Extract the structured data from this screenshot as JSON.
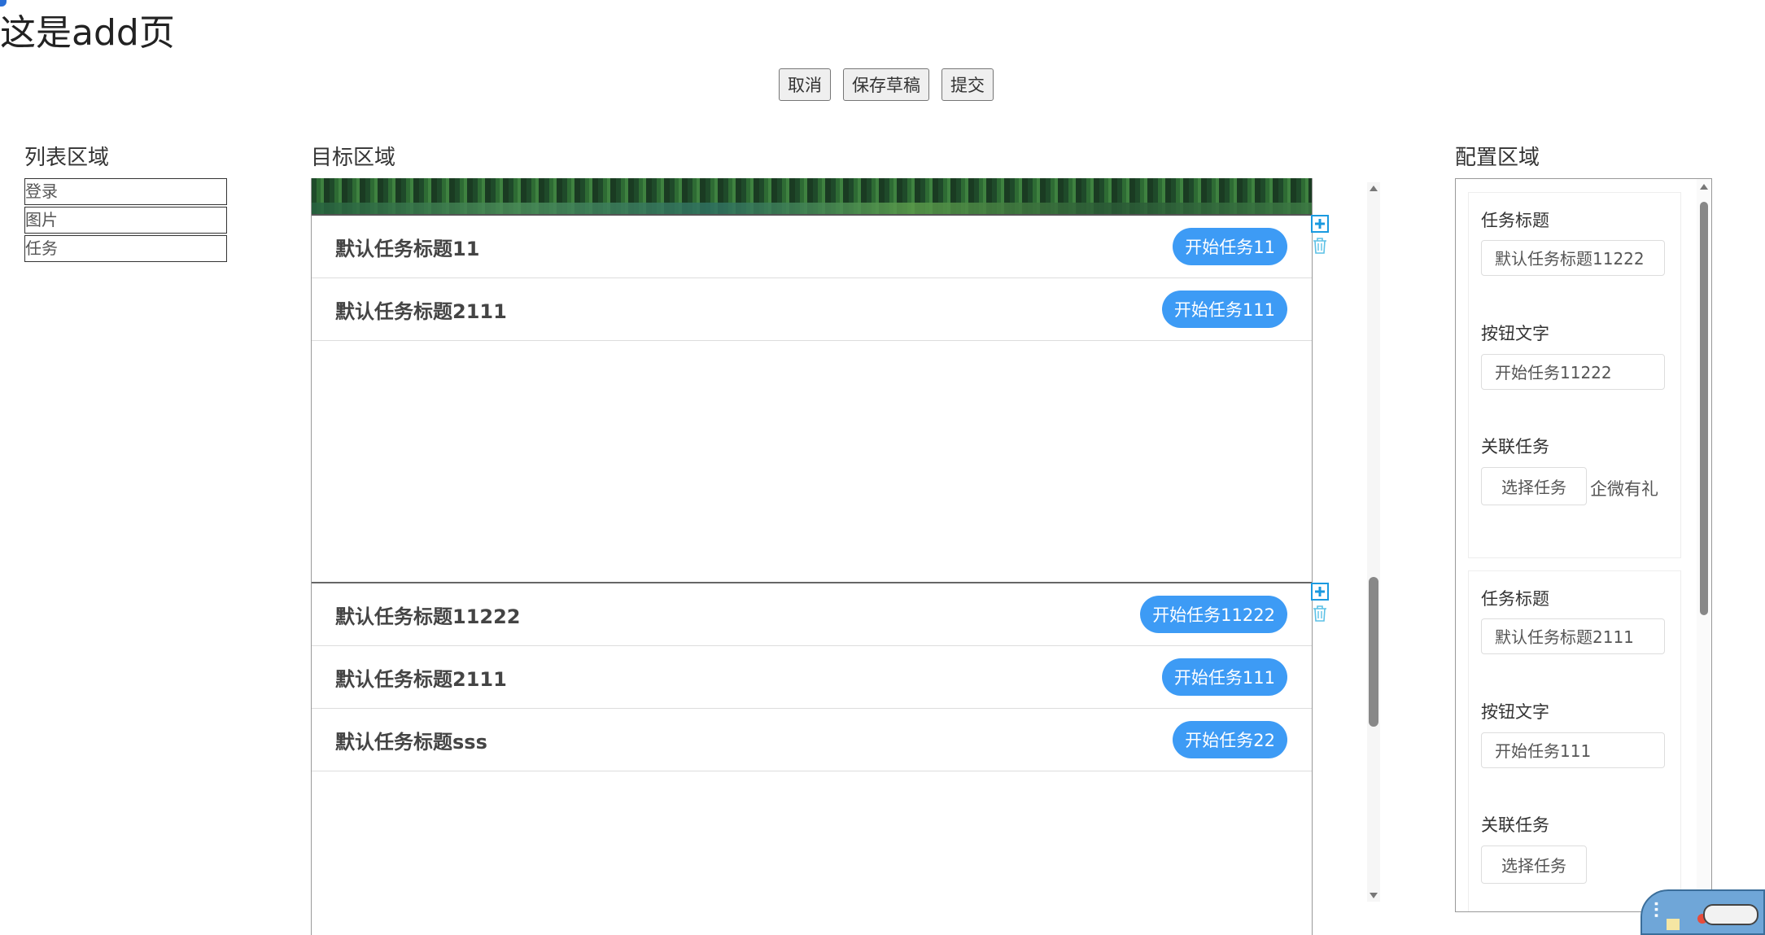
{
  "page": {
    "title": "这是add页"
  },
  "toolbar": {
    "cancel": "取消",
    "save_draft": "保存草稿",
    "submit": "提交"
  },
  "list_area": {
    "title": "列表区域",
    "items": [
      "登录",
      "图片",
      "任务"
    ]
  },
  "target_area": {
    "title": "目标区域",
    "modules": [
      {
        "tasks": [
          {
            "title": "默认任务标题11",
            "button": "开始任务11"
          },
          {
            "title": "默认任务标题2111",
            "button": "开始任务111"
          }
        ]
      },
      {
        "tasks": [
          {
            "title": "默认任务标题11222",
            "button": "开始任务11222"
          },
          {
            "title": "默认任务标题2111",
            "button": "开始任务111"
          },
          {
            "title": "默认任务标题sss",
            "button": "开始任务22"
          }
        ]
      }
    ]
  },
  "config_area": {
    "title": "配置区域",
    "cards": [
      {
        "task_title_label": "任务标题",
        "task_title_value": "默认任务标题11222",
        "button_text_label": "按钮文字",
        "button_text_value": "开始任务11222",
        "linked_label": "关联任务",
        "select_button": "选择任务",
        "linked_value": "企微有礼"
      },
      {
        "task_title_label": "任务标题",
        "task_title_value": "默认任务标题2111",
        "button_text_label": "按钮文字",
        "button_text_value": "开始任务111",
        "linked_label": "关联任务",
        "select_button": "选择任务",
        "linked_value": ""
      }
    ]
  },
  "colors": {
    "accent": "#3d9bf5",
    "icon": "#1a9ae0",
    "icon_light": "#5cc1e6"
  }
}
